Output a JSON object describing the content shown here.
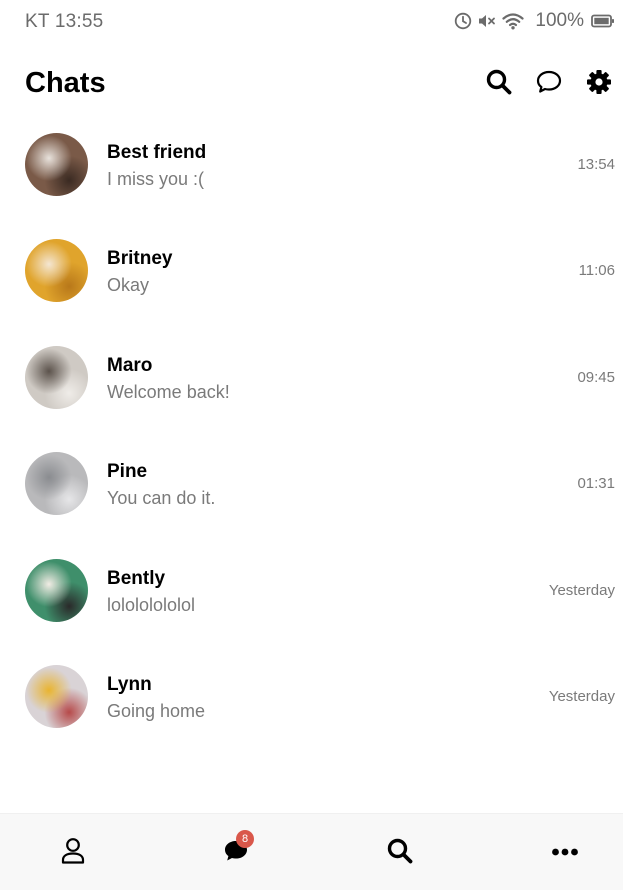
{
  "status_bar": {
    "carrier_time": "KT 13:55",
    "battery": "100%",
    "icons": [
      "alarm-icon",
      "mute-icon",
      "wifi-icon",
      "battery-icon"
    ]
  },
  "header": {
    "title": "Chats",
    "actions": [
      "search-icon",
      "new-chat-icon",
      "settings-icon"
    ]
  },
  "chats": [
    {
      "name": "Best friend",
      "preview": "I miss you :(",
      "time": "13:54",
      "avatar_colors": [
        "#7a5a48",
        "#e8e2dc",
        "#3a2a22"
      ]
    },
    {
      "name": "Britney",
      "preview": "Okay",
      "time": "11:06",
      "avatar_colors": [
        "#e0a42c",
        "#f4e6d2",
        "#b8781a"
      ]
    },
    {
      "name": "Maro",
      "preview": "Welcome back!",
      "time": "09:45",
      "avatar_colors": [
        "#cfcac4",
        "#5c534c",
        "#efece8"
      ]
    },
    {
      "name": "Pine",
      "preview": "You can do it.",
      "time": "01:31",
      "avatar_colors": [
        "#b9b9bb",
        "#8a8c90",
        "#e6e6e8"
      ]
    },
    {
      "name": "Bently",
      "preview": "lolololololol",
      "time": "Yesterday",
      "avatar_colors": [
        "#3f8f6b",
        "#f1ece4",
        "#2a2a2a"
      ]
    },
    {
      "name": "Lynn",
      "preview": "Going home",
      "time": "Yesterday",
      "avatar_colors": [
        "#d9d3d6",
        "#e9b430",
        "#b64a4a"
      ]
    }
  ],
  "bottom_nav": {
    "items": [
      "profile-icon",
      "chats-icon",
      "search-icon",
      "more-icon"
    ],
    "chats_badge": "8"
  },
  "colors": {
    "text_primary": "#000000",
    "text_secondary": "#7a7a7a",
    "badge": "#d9574a",
    "nav_background": "#f8f8f8"
  }
}
